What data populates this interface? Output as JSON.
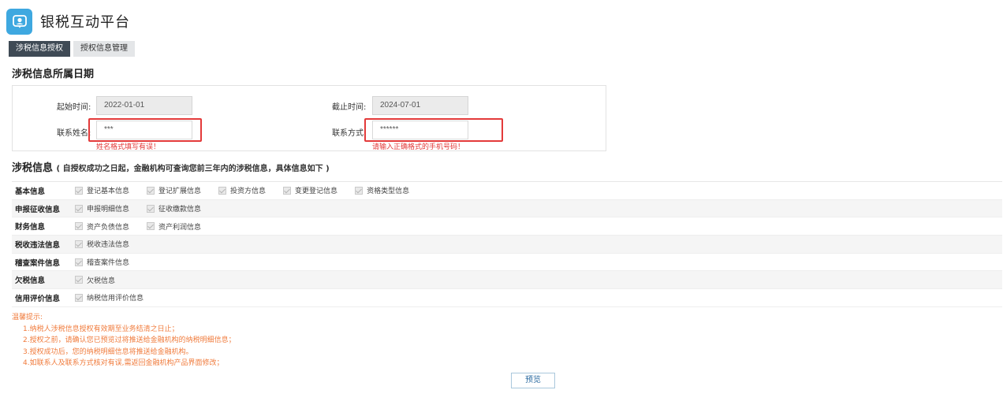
{
  "header": {
    "title": "银税互动平台",
    "logo_icon": "user-badge-icon"
  },
  "tabs": [
    {
      "label": "涉税信息授权",
      "active": true
    },
    {
      "label": "授权信息管理",
      "active": false
    }
  ],
  "date_section": {
    "title": "涉税信息所属日期",
    "start_label": "起始时间:",
    "start_value": "2022-01-01",
    "end_label": "截止时间:",
    "end_value": "2024-07-01",
    "contact_name_label": "联系姓名:",
    "contact_name_value": "***",
    "contact_name_error": "姓名格式填写有误！",
    "contact_phone_label": "联系方式:",
    "contact_phone_value": "******",
    "contact_phone_error": "请输入正确格式的手机号码！",
    "error_color": "#e33a3a"
  },
  "info_section": {
    "title": "涉税信息",
    "note": "( 自授权成功之日起，金融机构可查询您前三年内的涉税信息，具体信息如下 )",
    "rows": [
      {
        "label": "基本信息",
        "options": [
          "登记基本信息",
          "登记扩展信息",
          "投资方信息",
          "变更登记信息",
          "资格类型信息"
        ]
      },
      {
        "label": "申报征收信息",
        "options": [
          "申报明细信息",
          "征收缴款信息"
        ]
      },
      {
        "label": "财务信息",
        "options": [
          "资产负债信息",
          "资产利润信息"
        ]
      },
      {
        "label": "税收违法信息",
        "options": [
          "税收违法信息"
        ]
      },
      {
        "label": "稽查案件信息",
        "options": [
          "稽查案件信息"
        ]
      },
      {
        "label": "欠税信息",
        "options": [
          "欠税信息"
        ]
      },
      {
        "label": "信用评价信息",
        "options": [
          "纳税信用评价信息"
        ]
      }
    ]
  },
  "tips": {
    "title": "温馨提示:",
    "lines": [
      "1.纳税人涉税信息授权有效期至业务结清之日止；",
      "2.授权之前，请确认您已预览过将推送给金融机构的纳税明细信息；",
      "3.授权成功后，您的纳税明细信息将推送给金融机构。",
      "4.如联系人及联系方式核对有误,需返回金融机构产品界面修改；"
    ],
    "color": "#f07b3c"
  },
  "actions": {
    "preview_label": "预览"
  }
}
